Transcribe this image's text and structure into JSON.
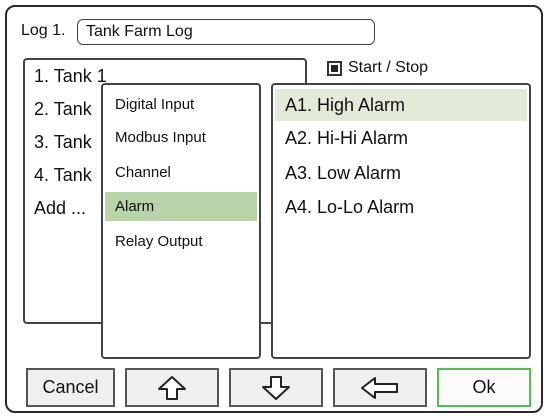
{
  "header": {
    "log_label": "Log 1.",
    "log_name": "Tank Farm Log"
  },
  "start_stop": {
    "label": "Start / Stop",
    "checked": true
  },
  "tanks": {
    "items": [
      "1. Tank 1",
      "2. Tank",
      "3. Tank",
      "4. Tank",
      "Add ..."
    ]
  },
  "input_types": {
    "items": [
      "Digital Input",
      "Modbus Input",
      "Channel",
      "Alarm",
      "Relay Output"
    ],
    "selected": "Alarm"
  },
  "alarms": {
    "items": [
      "A1. High Alarm",
      "A2. Hi-Hi Alarm",
      "A3. Low Alarm",
      "A4. Lo-Lo Alarm"
    ],
    "selected": "A1. High Alarm"
  },
  "buttons": {
    "cancel": "Cancel",
    "up_icon": "up-arrow-icon",
    "down_icon": "down-arrow-icon",
    "back_icon": "left-arrow-icon",
    "ok": "Ok"
  },
  "colors": {
    "selection_green": "#b9d4a9",
    "selection_light": "#e3ead8",
    "ok_border": "#4cc24c"
  }
}
